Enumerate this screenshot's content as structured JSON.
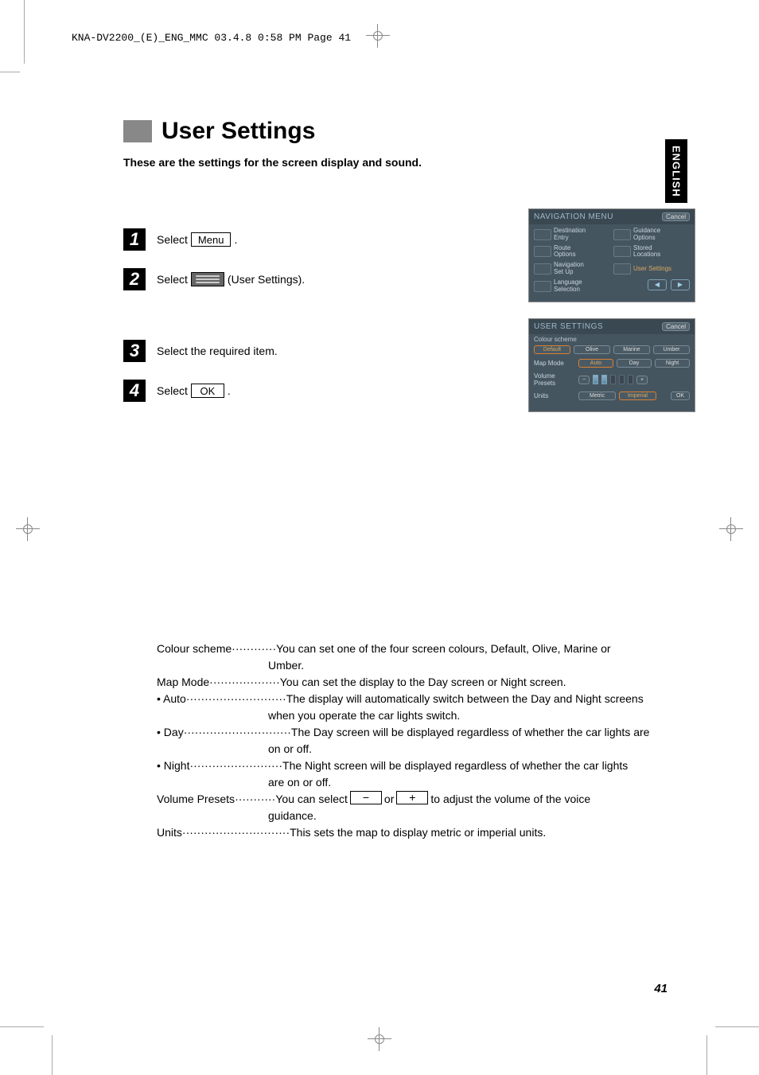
{
  "header_text": "KNA-DV2200_(E)_ENG_MMC  03.4.8  0:58 PM  Page 41",
  "side_tab": "ENGLISH",
  "title": "User Settings",
  "subtitle": "These are the settings for the screen display and sound.",
  "steps": {
    "s1": {
      "num": "1",
      "prefix": "Select",
      "btn": "Menu",
      "suffix": "."
    },
    "s2": {
      "num": "2",
      "prefix": "Select",
      "suffix": "(User Settings)."
    },
    "s3": {
      "num": "3",
      "text": "Select the required item."
    },
    "s4": {
      "num": "4",
      "prefix": "Select",
      "btn": "OK",
      "suffix": "."
    }
  },
  "nav_menu": {
    "title": "NAVIGATION MENU",
    "cancel": "Cancel",
    "items": [
      {
        "label": "Destination\nEntry"
      },
      {
        "label": "Guidance\nOptions"
      },
      {
        "label": "Route\nOptions"
      },
      {
        "label": "Stored\nLocations"
      },
      {
        "label": "Navigation\nSet Up"
      },
      {
        "label": "User Settings",
        "highlight": true
      },
      {
        "label": "Language\nSelection"
      }
    ],
    "prev": "◀",
    "next": "▶"
  },
  "user_settings_screen": {
    "title": "USER SETTINGS",
    "cancel": "Cancel",
    "colour_label": "Colour scheme",
    "colour_opts": [
      "Default",
      "Olive",
      "Marine",
      "Umber"
    ],
    "map_label": "Map Mode",
    "map_opts": [
      "Auto",
      "Day",
      "Night"
    ],
    "vol_label": "Volume Presets",
    "vol_minus": "−",
    "vol_plus": "+",
    "units_label": "Units",
    "units_opts": [
      "Metric",
      "Imperial"
    ],
    "ok": "OK"
  },
  "desc": {
    "colour_term": "Colour scheme",
    "colour_text1": "You can set one of the four screen colours, Default, Olive, Marine or",
    "colour_text2": "Umber.",
    "map_term": "Map Mode",
    "map_text": "You can set the display to the Day screen or Night screen.",
    "auto_term": "• Auto",
    "auto_text1": "The display will automatically switch between the Day and Night screens",
    "auto_text2": "when you operate the car lights switch.",
    "day_term": "• Day",
    "day_text1": "The Day screen will be displayed regardless of whether the car lights are",
    "day_text2": "on or off.",
    "night_term": "• Night",
    "night_text1": "The Night screen will be displayed regardless of whether the car lights",
    "night_text2": "are on or off.",
    "vol_term": "Volume Presets",
    "vol_text1": "You can select",
    "vol_or": "or",
    "vol_text2": "to adjust the volume of the voice",
    "vol_text3": "guidance.",
    "units_term": "Units",
    "units_text": " This sets the map to display metric or imperial units.",
    "minus": "−",
    "plus": "+"
  },
  "page_number": "41"
}
